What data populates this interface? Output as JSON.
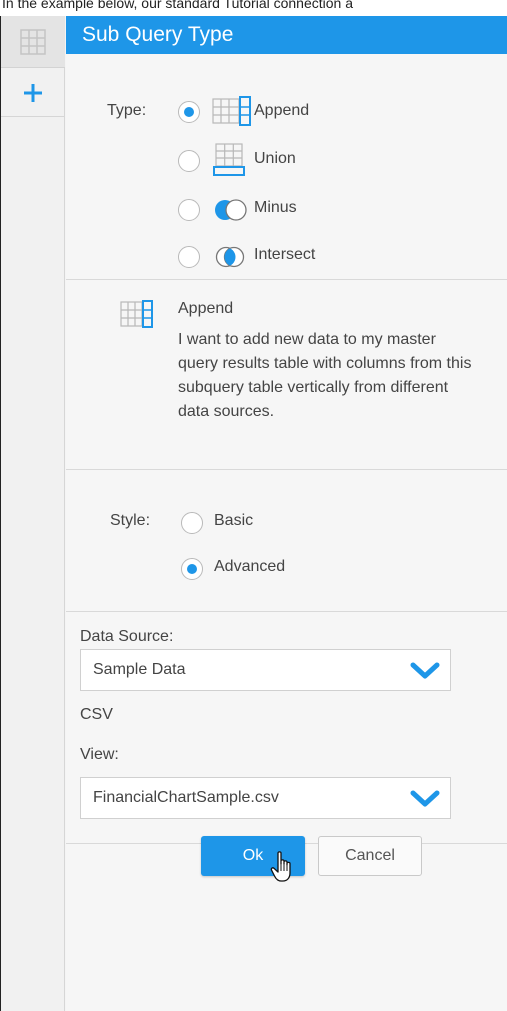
{
  "caption": "In the example below, our standard Tutorial connection a",
  "dialog": {
    "title": "Sub Query Type",
    "type_label": "Type:",
    "type_options": [
      {
        "label": "Append",
        "selected": true,
        "icon": "append-icon"
      },
      {
        "label": "Union",
        "selected": false,
        "icon": "union-icon"
      },
      {
        "label": "Minus",
        "selected": false,
        "icon": "minus-icon"
      },
      {
        "label": "Intersect",
        "selected": false,
        "icon": "intersect-icon"
      }
    ],
    "description": {
      "title": "Append",
      "text": "I want to add new data to my master query results table with columns from this subquery table vertically from different data sources."
    },
    "style_label": "Style:",
    "style_options": [
      {
        "label": "Basic",
        "selected": false
      },
      {
        "label": "Advanced",
        "selected": true
      }
    ],
    "data_source_label": "Data Source:",
    "data_source_value": "Sample Data",
    "data_source_type": "CSV",
    "view_label": "View:",
    "view_value": "FinancialChartSample.csv",
    "ok_label": "Ok",
    "cancel_label": "Cancel"
  },
  "colors": {
    "accent": "#1e96e8"
  }
}
